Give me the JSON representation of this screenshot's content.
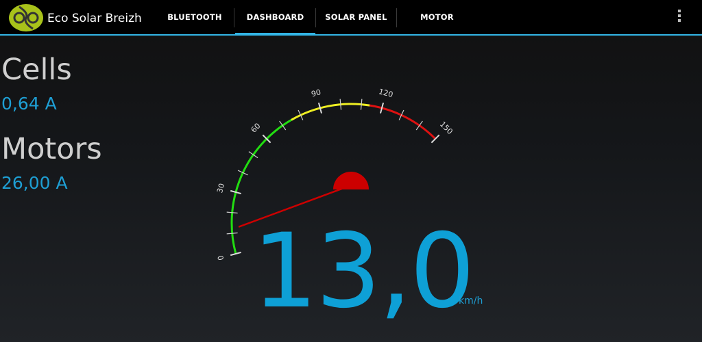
{
  "app": {
    "title": "Eco Solar Breizh",
    "logo_icon": "eco-solar-logo"
  },
  "tabs": [
    {
      "label": "BLUETOOTH",
      "selected": false
    },
    {
      "label": "DASHBOARD",
      "selected": true
    },
    {
      "label": "SOLAR PANEL",
      "selected": false
    },
    {
      "label": "MOTOR",
      "selected": false
    }
  ],
  "overflow_icon": "overflow-menu-icon",
  "metrics": {
    "cells": {
      "label": "Cells",
      "value": "0,64 A"
    },
    "motors": {
      "label": "Motors",
      "value": "26,00 A"
    }
  },
  "gauge": {
    "min": 0,
    "max": 150,
    "major_labels": [
      "0",
      "30",
      "60",
      "90",
      "120",
      "150"
    ],
    "zones": [
      {
        "from": 0,
        "to": 75,
        "color": "#22dd11"
      },
      {
        "from": 75,
        "to": 114,
        "color": "#eeee22"
      },
      {
        "from": 114,
        "to": 150,
        "color": "#dd1111"
      }
    ],
    "needle_value": 13.0,
    "needle_color": "#cc0000"
  },
  "speed": {
    "value": "13,0",
    "unit": "km/h"
  },
  "colors": {
    "accent": "#33b5e5",
    "value_text": "#1e9fd4"
  }
}
